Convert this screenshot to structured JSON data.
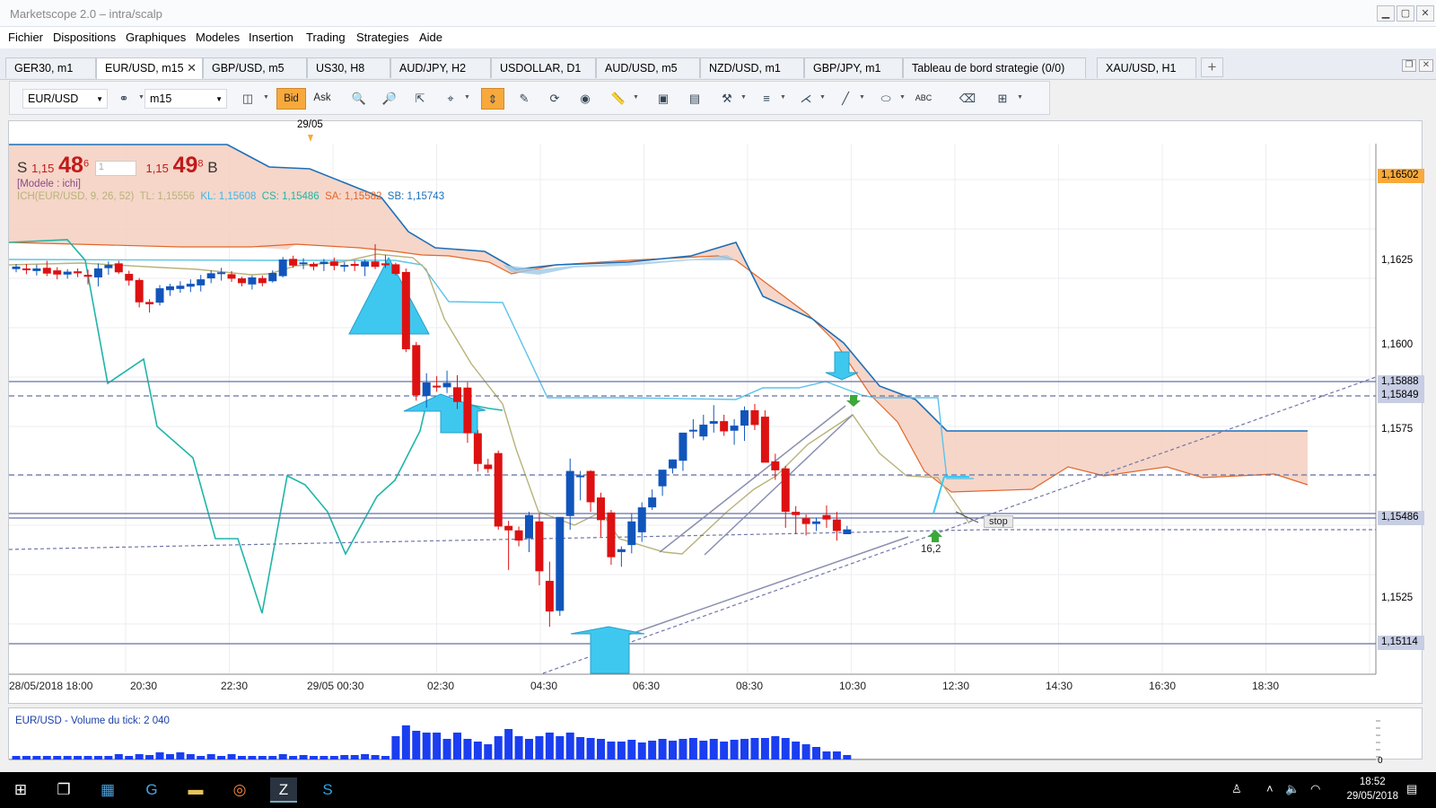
{
  "window": {
    "title": "Marketscope 2.0 – intra/scalp"
  },
  "menu": [
    "Fichier",
    "Dispositions",
    "Graphiques",
    "Modeles",
    "Insertion",
    "Trading",
    "Strategies",
    "Aide"
  ],
  "tabs": [
    "GER30, m1",
    "EUR/USD, m15",
    "GBP/USD, m5",
    "US30, H8",
    "AUD/JPY, H2",
    "USDOLLAR, D1",
    "AUD/USD, m5",
    "NZD/USD, m1",
    "GBP/JPY, m1",
    "Tableau de bord strategie (0/0)",
    "XAU/USD, H1"
  ],
  "active_tab": "EUR/USD, m15",
  "tab_close": "✕",
  "add_tab": "+",
  "toolbar": {
    "symbol": "EUR/USD",
    "timeframe": "m15",
    "bid": "Bid",
    "ask": "Ask",
    "abc": "ABC"
  },
  "quote": {
    "sell_label": "S",
    "sell_prefix": "1,15",
    "sell_big": "48",
    "sell_sup": "6",
    "qty_placeholder": "1",
    "buy_prefix": "1,15",
    "buy_big": "49",
    "buy_sup": "8",
    "buy_label": "B"
  },
  "model_label": "[Modele : ichi]",
  "ichimoku_label": {
    "name": "ICH(EUR/USD, 9, 26, 52)",
    "tl": "TL: 1,15556",
    "kl": "KL: 1,15608",
    "cs": "CS: 1,15486",
    "sa": "SA: 1,15582",
    "sb": "SB: 1,15743"
  },
  "date_marker": "29/05",
  "price_labels": {
    "p1": "1,16502",
    "p2": "1,1625",
    "p3": "1,1600",
    "p4": "1,15888",
    "p5": "1,15849",
    "p6": "1,1575",
    "p7": "1,15486",
    "p8": "1,1525",
    "p9": "1,15114"
  },
  "time_labels": [
    "28/05/2018 18:00",
    "20:30",
    "22:30",
    "29/05 00:30",
    "02:30",
    "04:30",
    "06:30",
    "08:30",
    "10:30",
    "12:30",
    "14:30",
    "16:30",
    "18:30"
  ],
  "stop_label": "stop",
  "pip_label": "16,2",
  "volume_label": "EUR/USD - Volume du tick: 2 040",
  "volume_axis_zero": "0",
  "taskbar": {
    "time": "18:52",
    "date": "29/05/2018"
  },
  "colors": {
    "up": "#1155bb",
    "down": "#dd1111",
    "cloud": "#f5cfc0",
    "kijun": "#5bc3ea",
    "senkou_b": "#1c6fb8",
    "senkou_a": "#e2662a",
    "tenkan": "#b8b27a",
    "chikou": "#1fb5a8",
    "arrow": "#3ec8f0",
    "hline": "#6672a8"
  },
  "chart_data": {
    "type": "candlestick",
    "symbol": "EUR/USD",
    "timeframe": "m15",
    "ylim": [
      1.15,
      1.1665
    ],
    "horizontal_levels": [
      1.15888,
      1.15849,
      1.15628,
      1.15486,
      1.15114
    ],
    "candles_ohlc": [
      [
        1.1626,
        1.16276,
        1.1625,
        1.16268
      ],
      [
        1.16262,
        1.16276,
        1.16244,
        1.16257
      ],
      [
        1.16254,
        1.16274,
        1.1624,
        1.16262
      ],
      [
        1.16264,
        1.16286,
        1.16238,
        1.16246
      ],
      [
        1.16256,
        1.16266,
        1.16228,
        1.16243
      ],
      [
        1.16243,
        1.1626,
        1.1623,
        1.16252
      ],
      [
        1.16253,
        1.16262,
        1.16235,
        1.16247
      ],
      [
        1.16242,
        1.16258,
        1.16212,
        1.16236
      ],
      [
        1.16234,
        1.16278,
        1.16206,
        1.16262
      ],
      [
        1.16263,
        1.16284,
        1.16242,
        1.16273
      ],
      [
        1.16278,
        1.16286,
        1.16245,
        1.1625
      ],
      [
        1.16245,
        1.16255,
        1.16208,
        1.16224
      ],
      [
        1.16226,
        1.16232,
        1.1614,
        1.16156
      ],
      [
        1.16157,
        1.16166,
        1.16124,
        1.1615
      ],
      [
        1.16155,
        1.1621,
        1.16146,
        1.162
      ],
      [
        1.16194,
        1.16214,
        1.16176,
        1.16206
      ],
      [
        1.16198,
        1.16222,
        1.16186,
        1.16208
      ],
      [
        1.16205,
        1.16228,
        1.16188,
        1.16214
      ],
      [
        1.16209,
        1.16242,
        1.1619,
        1.16228
      ],
      [
        1.16231,
        1.16256,
        1.16216,
        1.16247
      ],
      [
        1.16248,
        1.16264,
        1.16224,
        1.1625
      ],
      [
        1.16244,
        1.16254,
        1.1622,
        1.1623
      ],
      [
        1.16231,
        1.16236,
        1.16206,
        1.16216
      ],
      [
        1.16212,
        1.1624,
        1.16196,
        1.16234
      ],
      [
        1.16232,
        1.1624,
        1.16206,
        1.16216
      ],
      [
        1.16222,
        1.16256,
        1.16218,
        1.16248
      ],
      [
        1.16238,
        1.16298,
        1.16234,
        1.1629
      ],
      [
        1.16292,
        1.16302,
        1.16264,
        1.16271
      ],
      [
        1.16276,
        1.16294,
        1.1626,
        1.16281
      ],
      [
        1.16276,
        1.16282,
        1.16256,
        1.16268
      ],
      [
        1.16276,
        1.16292,
        1.16254,
        1.16283
      ],
      [
        1.16284,
        1.16296,
        1.16256,
        1.1627
      ],
      [
        1.1627,
        1.16282,
        1.16252,
        1.16273
      ],
      [
        1.16276,
        1.16286,
        1.16254,
        1.1627
      ],
      [
        1.16268,
        1.1629,
        1.16238,
        1.16284
      ],
      [
        1.16284,
        1.16338,
        1.1626,
        1.16267
      ],
      [
        1.16278,
        1.16304,
        1.16264,
        1.16272
      ],
      [
        1.16275,
        1.1628,
        1.1624,
        1.16245
      ],
      [
        1.16251,
        1.16262,
        1.16,
        1.16009
      ],
      [
        1.16022,
        1.16032,
        1.15848,
        1.15865
      ],
      [
        1.15863,
        1.15934,
        1.15826,
        1.15905
      ],
      [
        1.15895,
        1.15925,
        1.15876,
        1.1589
      ],
      [
        1.1589,
        1.15942,
        1.15872,
        1.15904
      ],
      [
        1.1589,
        1.15928,
        1.15822,
        1.15844
      ],
      [
        1.15889,
        1.15906,
        1.15716,
        1.15746
      ],
      [
        1.15746,
        1.15756,
        1.15626,
        1.1565
      ],
      [
        1.15648,
        1.15666,
        1.15622,
        1.15634
      ],
      [
        1.15684,
        1.15692,
        1.15444,
        1.15454
      ],
      [
        1.15456,
        1.15472,
        1.15318,
        1.15442
      ],
      [
        1.15442,
        1.15454,
        1.15392,
        1.1541
      ],
      [
        1.15417,
        1.155,
        1.15374,
        1.1549
      ],
      [
        1.1547,
        1.15494,
        1.1527,
        1.15314
      ],
      [
        1.15284,
        1.15344,
        1.1514,
        1.15188
      ],
      [
        1.1519,
        1.15436,
        1.15174,
        1.15484
      ],
      [
        1.15487,
        1.15667,
        1.15444,
        1.15628
      ],
      [
        1.15612,
        1.15628,
        1.15536,
        1.15614
      ],
      [
        1.15628,
        1.1563,
        1.155,
        1.1553
      ],
      [
        1.15545,
        1.1556,
        1.15422,
        1.15474
      ],
      [
        1.15498,
        1.15506,
        1.15334,
        1.15358
      ],
      [
        1.15374,
        1.15392,
        1.15328,
        1.15383
      ],
      [
        1.15396,
        1.15496,
        1.1537,
        1.1547
      ],
      [
        1.15436,
        1.1553,
        1.15406,
        1.15514
      ],
      [
        1.15514,
        1.1557,
        1.15506,
        1.15545
      ],
      [
        1.1558,
        1.15616,
        1.1555,
        1.15632
      ],
      [
        1.15636,
        1.15664,
        1.1562,
        1.15664
      ],
      [
        1.1566,
        1.15704,
        1.15628,
        1.15748
      ],
      [
        1.15756,
        1.1579,
        1.1573,
        1.15757
      ],
      [
        1.15736,
        1.15804,
        1.15724,
        1.15773
      ],
      [
        1.15776,
        1.15834,
        1.15748,
        1.15784
      ],
      [
        1.15784,
        1.15804,
        1.15738,
        1.15752
      ],
      [
        1.15754,
        1.1579,
        1.1571,
        1.1577
      ],
      [
        1.1577,
        1.1583,
        1.15722,
        1.15818
      ],
      [
        1.15818,
        1.15838,
        1.15756,
        1.15772
      ],
      [
        1.15798,
        1.15818,
        1.15686,
        1.15654
      ],
      [
        1.15658,
        1.15682,
        1.156,
        1.1563
      ],
      [
        1.15636,
        1.15644,
        1.1545,
        1.155
      ],
      [
        1.155,
        1.15518,
        1.1543,
        1.1549
      ],
      [
        1.1548,
        1.15492,
        1.15426,
        1.15462
      ],
      [
        1.15462,
        1.15482,
        1.1544,
        1.1547
      ],
      [
        1.1549,
        1.1552,
        1.1545,
        1.15476
      ],
      [
        1.15476,
        1.155,
        1.1541,
        1.1544
      ],
      [
        1.1543,
        1.15456,
        1.1544,
        1.15445
      ]
    ],
    "ichimoku": {
      "params": [
        9,
        26,
        52
      ],
      "tenkan": [
        1.15556
      ],
      "kijun": [
        1.15608
      ],
      "chikou": [
        1.15486
      ],
      "senkou_a": [
        1.15582
      ],
      "senkou_b": [
        1.15743
      ]
    },
    "volume": [
      4,
      4,
      4,
      4,
      4,
      4,
      4,
      4,
      4,
      4,
      6,
      4,
      6,
      5,
      8,
      6,
      8,
      6,
      4,
      6,
      4,
      6,
      4,
      4,
      4,
      4,
      6,
      4,
      5,
      4,
      4,
      4,
      5,
      5,
      6,
      5,
      4,
      26,
      38,
      32,
      30,
      30,
      23,
      30,
      23,
      20,
      17,
      26,
      34,
      26,
      23,
      26,
      30,
      26,
      30,
      25,
      24,
      23,
      20,
      20,
      22,
      19,
      21,
      23,
      21,
      23,
      24,
      21,
      23,
      20,
      22,
      23,
      24,
      24,
      26,
      24,
      20,
      17,
      14,
      9,
      9,
      5
    ],
    "volume_total": 2040
  }
}
